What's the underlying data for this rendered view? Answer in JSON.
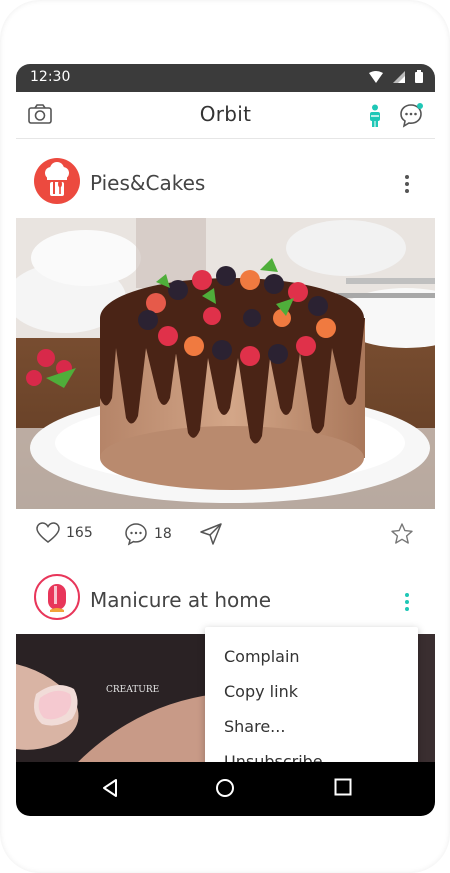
{
  "status_bar": {
    "time": "12:30"
  },
  "app_bar": {
    "title": "Orbit",
    "icons": [
      "camera-icon",
      "person-icon",
      "chat-icon"
    ],
    "accent_color": "#1fc7b6"
  },
  "posts": [
    {
      "author": "Pies&Cakes",
      "avatar_color": "#ec4a3f",
      "likes": "165",
      "comments": "18"
    },
    {
      "author": "Manicure at home",
      "avatar_color": "#e8365a"
    }
  ],
  "context_menu": {
    "items": [
      "Complain",
      "Copy link",
      "Share...",
      "Unsubscribe"
    ]
  },
  "watermark": "CREATURE"
}
